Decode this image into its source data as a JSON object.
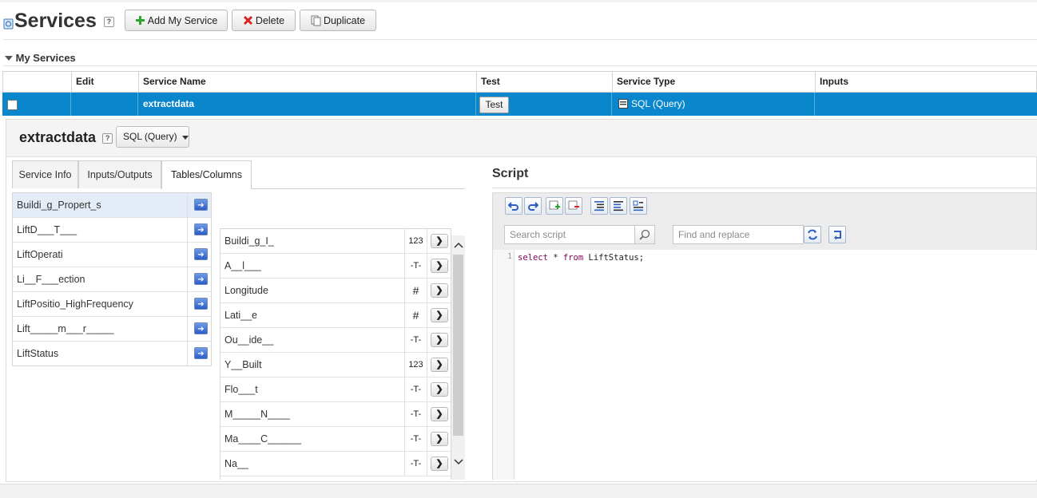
{
  "page": {
    "title": "Services",
    "help": "?"
  },
  "toolbar": {
    "add_label": "Add My Service",
    "delete_label": "Delete",
    "duplicate_label": "Duplicate"
  },
  "section": {
    "title": "My Services"
  },
  "grid": {
    "headers": {
      "edit": "Edit",
      "name": "Service Name",
      "test": "Test",
      "type": "Service Type",
      "inputs": "Inputs"
    },
    "row": {
      "name": "extractdata",
      "test_label": "Test",
      "type": "SQL (Query)"
    }
  },
  "detail": {
    "name": "extractdata",
    "help": "?",
    "type_select": "SQL (Query)",
    "tabs": [
      "Service Info",
      "Inputs/Outputs",
      "Tables/Columns"
    ],
    "active_tab": "Tables/Columns",
    "tables": [
      {
        "label": "Buildi_g_Propert_s",
        "selected": true
      },
      {
        "label": "LiftD___T___"
      },
      {
        "label": "LiftOperati"
      },
      {
        "label": "Li__F___ection"
      },
      {
        "label": "LiftPositio_HighFrequency"
      },
      {
        "label": "Lift_____m___r_____"
      },
      {
        "label": "LiftStatus"
      }
    ],
    "columns": [
      {
        "label": "Buildi_g_I_",
        "type": "123"
      },
      {
        "label": "A__l___",
        "type": "-T-"
      },
      {
        "label": "Longitude",
        "type": "#"
      },
      {
        "label": "Lati__e",
        "type": "#"
      },
      {
        "label": "Ou__ide__",
        "type": "-T-"
      },
      {
        "label": "Y__Built",
        "type": "123"
      },
      {
        "label": "Flo___t",
        "type": "-T-"
      },
      {
        "label": "M_____N____",
        "type": "-T-"
      },
      {
        "label": "Ma____C______",
        "type": "-T-"
      },
      {
        "label": "Na__",
        "type": "-T-"
      }
    ]
  },
  "script": {
    "title": "Script",
    "search_placeholder": "Search script",
    "replace_placeholder": "Find and replace",
    "line_number": "1",
    "code_keywords": [
      "select",
      "from"
    ],
    "code": {
      "kw1": "select",
      "star": " * ",
      "kw2": "from",
      "rest": " LiftStatus;"
    }
  },
  "colors": {
    "selected_row": "#0a86cd",
    "accent_blue": "#2c5dc8"
  },
  "icons": [
    "services-icon",
    "add-icon",
    "delete-icon",
    "duplicate-icon",
    "collapse-triangle-icon",
    "sql-icon",
    "undo-icon",
    "redo-icon",
    "search-icon",
    "replace-icon",
    "replace-all-icon"
  ]
}
